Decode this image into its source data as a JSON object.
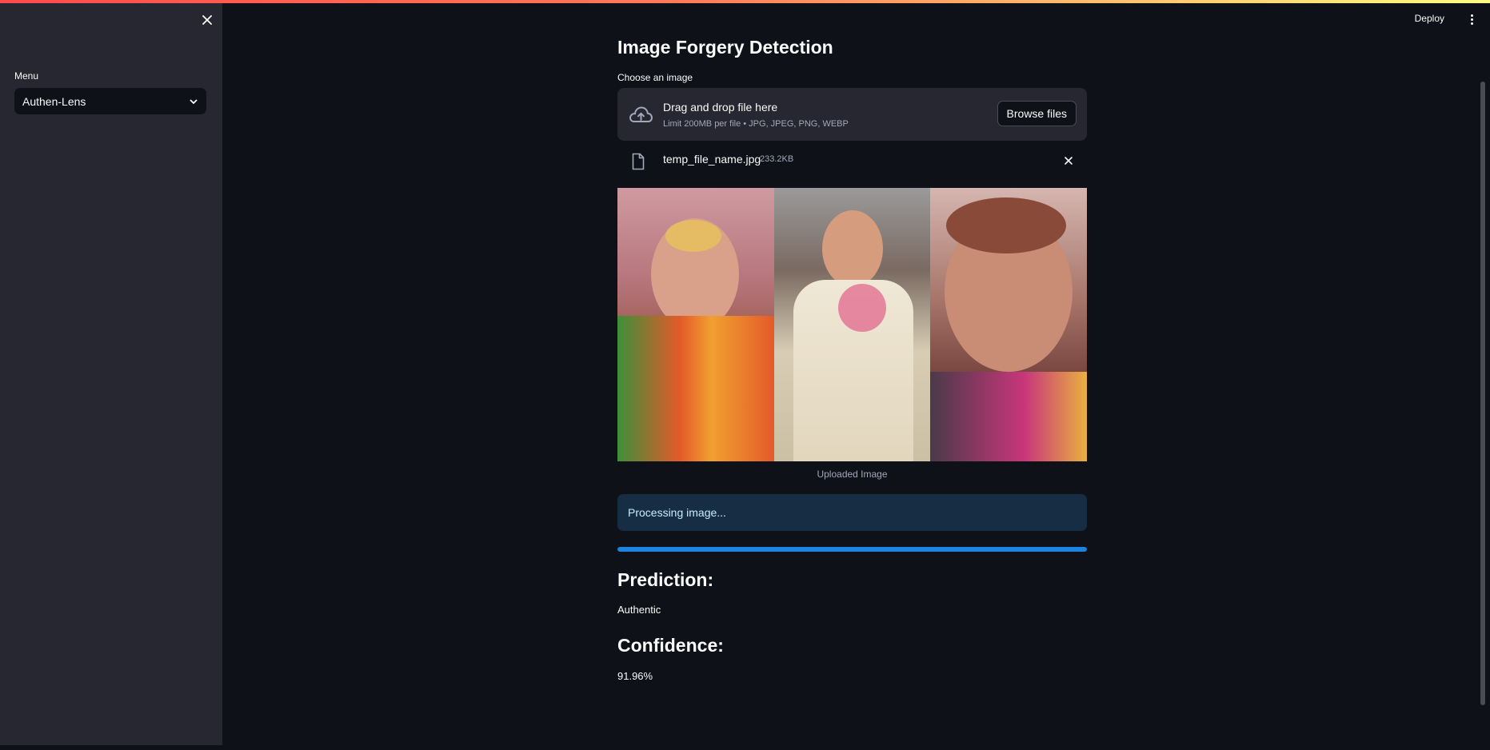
{
  "sidebar": {
    "menu_label": "Menu",
    "menu_selected": "Authen-Lens"
  },
  "header": {
    "deploy_label": "Deploy"
  },
  "main": {
    "title": "Image Forgery Detection",
    "uploader": {
      "label": "Choose an image",
      "drag_text": "Drag and drop file here",
      "limit_text": "Limit 200MB per file • JPG, JPEG, PNG, WEBP",
      "browse_label": "Browse files"
    },
    "file": {
      "name": "temp_file_name.jpg",
      "size": "233.2KB"
    },
    "image_caption": "Uploaded Image",
    "status": "Processing image...",
    "progress": 1.0,
    "prediction_heading": "Prediction:",
    "prediction_value": "Authentic",
    "confidence_heading": "Confidence:",
    "confidence_value": "91.96%"
  },
  "colors": {
    "accent": "#1c83e1",
    "info_bg": "#172d43",
    "sidebar_bg": "#262730",
    "app_bg": "#0e1117"
  }
}
